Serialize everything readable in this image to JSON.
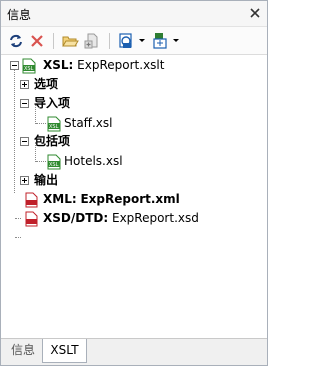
{
  "window": {
    "title": "信息"
  },
  "toolbar": {
    "buttons": [
      {
        "name": "refresh-icon"
      },
      {
        "name": "delete-icon"
      },
      {
        "name": "open-folder-icon"
      },
      {
        "name": "add-file-icon"
      },
      {
        "name": "schema-mapping-icon"
      },
      {
        "name": "xpath-mapping-icon"
      }
    ]
  },
  "tree": {
    "root": {
      "prefix": "XSL:",
      "value": "ExpReport.xslt"
    },
    "options": "选项",
    "imports": "导入项",
    "import_file": "Staff.xsl",
    "includes": "包括项",
    "include_file": "Hotels.xsl",
    "output": "输出",
    "xml": {
      "prefix": "XML:",
      "value": "ExpReport.xml"
    },
    "xsd": {
      "prefix": "XSD/DTD:",
      "value": "ExpReport.xsd"
    }
  },
  "tabs": [
    {
      "label": "信息",
      "active": false
    },
    {
      "label": "XSLT",
      "active": true
    }
  ],
  "colors": {
    "xsl_green": "#2f8a2f",
    "xml_red": "#c0202a",
    "accent_blue": "#1c5fb0"
  }
}
